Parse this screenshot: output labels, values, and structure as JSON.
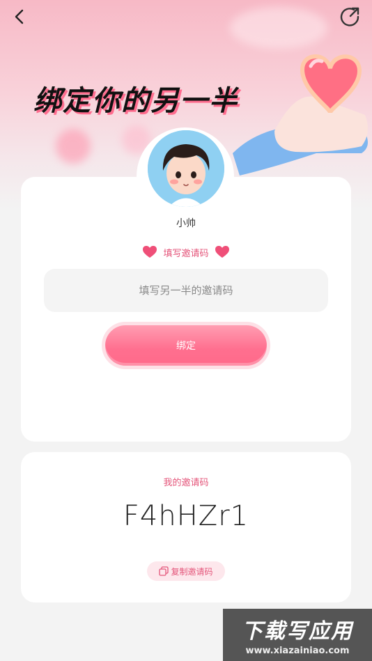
{
  "header": {
    "title": "绑定你的另一半",
    "back_icon": "chevron-left-icon",
    "share_icon": "share-arrow-icon"
  },
  "profile": {
    "nickname": "小帅"
  },
  "bind_section": {
    "label": "填写邀请码",
    "input_value": "",
    "input_placeholder": "填写另一半的邀请码",
    "bind_button_label": "绑定"
  },
  "my_code_section": {
    "label": "我的邀请码",
    "code": "F4hHZr1",
    "copy_button_label": "复制邀请码"
  },
  "watermark": {
    "title": "下载写应用",
    "url": "www.xiazainiao.com"
  },
  "colors": {
    "accent": "#e4557a",
    "button": "#ff6f8f",
    "hero_top": "#f7b9c6",
    "background": "#f3f3f3"
  }
}
